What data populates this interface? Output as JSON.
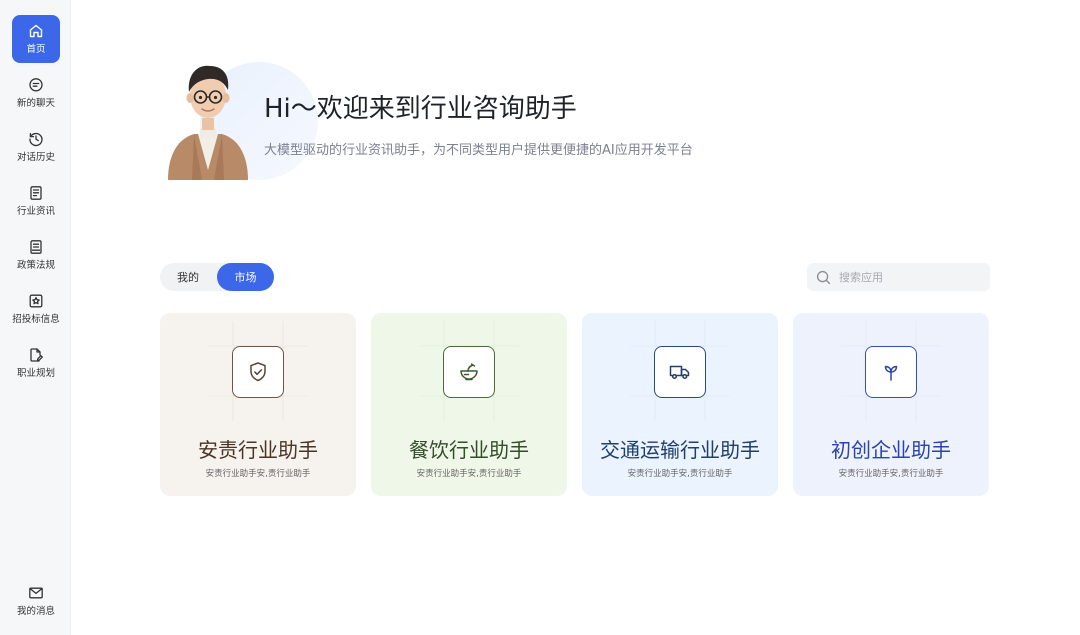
{
  "sidebar": {
    "items": [
      {
        "label": "首页",
        "icon": "home-icon",
        "active": true
      },
      {
        "label": "新的聊天",
        "icon": "chat-bubble-icon"
      },
      {
        "label": "对话历史",
        "icon": "history-icon"
      },
      {
        "label": "行业资讯",
        "icon": "news-icon"
      },
      {
        "label": "政策法规",
        "icon": "policy-document-icon"
      },
      {
        "label": "招投标信息",
        "icon": "bidding-star-icon"
      },
      {
        "label": "职业规划",
        "icon": "edit-document-icon"
      }
    ],
    "bottom": {
      "label": "我的消息",
      "icon": "mail-icon"
    }
  },
  "hero": {
    "title": "Hi～欢迎来到行业咨询助手",
    "subtitle": "大模型驱动的行业资讯助手，为不同类型用户提供更便捷的AI应用开发平台"
  },
  "tabs": [
    {
      "label": "我的",
      "active": false
    },
    {
      "label": "市场",
      "active": true
    }
  ],
  "search": {
    "placeholder": "搜索应用",
    "value": ""
  },
  "cards": [
    {
      "title": "安责行业助手",
      "desc": "安责行业助手安,责行业助手",
      "icon": "shield-check-icon",
      "accent": "#6e5442",
      "bg": "#f6f2ed"
    },
    {
      "title": "餐饮行业助手",
      "desc": "安责行业助手安,责行业助手",
      "icon": "food-bowl-icon",
      "accent": "#4a6a3a",
      "bg": "#eff7e9"
    },
    {
      "title": "交通运输行业助手",
      "desc": "安责行业助手安,责行业助手",
      "icon": "truck-icon",
      "accent": "#2a4a78",
      "bg": "#ebf3fe"
    },
    {
      "title": "初创企业助手",
      "desc": "安责行业助手安,责行业助手",
      "icon": "sprout-icon",
      "accent": "#3350b8",
      "bg": "#eef2fd"
    }
  ],
  "colors": {
    "primary": "#3b67e8",
    "sidebar_bg": "#f6f7f9"
  }
}
